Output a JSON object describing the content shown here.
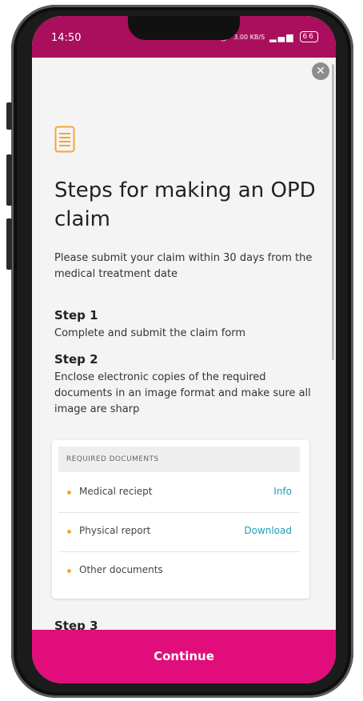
{
  "status_bar": {
    "time": "14:50",
    "network_speed": "3.00 KB/S",
    "battery_level": "66"
  },
  "header": {
    "close_icon": "close-icon",
    "document_icon": "document-list-icon",
    "title": "Steps for making an OPD claim",
    "intro": "Please submit your claim within 30 days from the medical treatment date"
  },
  "steps": [
    {
      "title": "Step 1",
      "text": "Complete and submit the claim form"
    },
    {
      "title": "Step 2",
      "text": "Enclose electronic copies of the required documents in an image format and make sure all image are sharp"
    },
    {
      "title": "Step 3",
      "text": ""
    }
  ],
  "required_documents": {
    "header": "REQUIRED DOCUMENTS",
    "items": [
      {
        "label": "Medical reciept",
        "action": "Info"
      },
      {
        "label": "Physical report",
        "action": "Download"
      },
      {
        "label": "Other documents",
        "action": ""
      }
    ]
  },
  "footer": {
    "continue_label": "Continue"
  },
  "colors": {
    "status_bar": "#a90f5c",
    "primary": "#e10d7a",
    "link": "#1f9db6",
    "bullet": "#f4a636",
    "icon": "#f4a636"
  }
}
